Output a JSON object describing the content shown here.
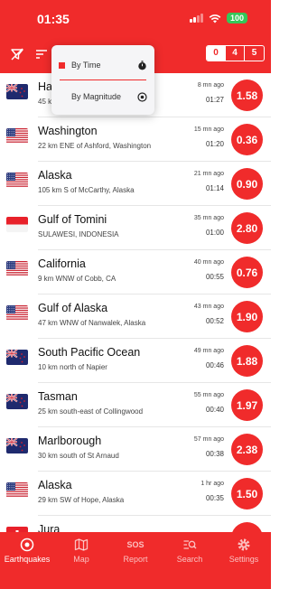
{
  "status_bar": {
    "time": "01:35",
    "battery": "100"
  },
  "toolbar": {
    "counts": [
      "0",
      "4",
      "5"
    ]
  },
  "sort_menu": {
    "items": [
      {
        "label": "By Time",
        "selected": true,
        "icon": "stopwatch-icon"
      },
      {
        "label": "By Magnitude",
        "selected": false,
        "icon": "target-icon"
      }
    ]
  },
  "earthquakes": [
    {
      "place": "Ha",
      "detail": "45 k",
      "ago": "8 mn ago",
      "time": "01:27",
      "magnitude": "1.58",
      "flag": "nz"
    },
    {
      "place": "Washington",
      "detail": "22 km ENE of Ashford, Washington",
      "ago": "15 mn ago",
      "time": "01:20",
      "magnitude": "0.36",
      "flag": "us"
    },
    {
      "place": "Alaska",
      "detail": "105 km S of McCarthy, Alaska",
      "ago": "21 mn ago",
      "time": "01:14",
      "magnitude": "0.90",
      "flag": "us"
    },
    {
      "place": "Gulf of Tomini",
      "detail": "SULAWESI, INDONESIA",
      "ago": "35 mn ago",
      "time": "01:00",
      "magnitude": "2.80",
      "flag": "id"
    },
    {
      "place": "California",
      "detail": "9 km WNW of Cobb, CA",
      "ago": "40 mn ago",
      "time": "00:55",
      "magnitude": "0.76",
      "flag": "us"
    },
    {
      "place": "Gulf of Alaska",
      "detail": "47 km WNW of Nanwalek, Alaska",
      "ago": "43 mn ago",
      "time": "00:52",
      "magnitude": "1.90",
      "flag": "us"
    },
    {
      "place": "South Pacific Ocean",
      "detail": "10 km north of Napier",
      "ago": "49 mn ago",
      "time": "00:46",
      "magnitude": "1.88",
      "flag": "nz"
    },
    {
      "place": "Tasman",
      "detail": "25 km south-east of Collingwood",
      "ago": "55 mn ago",
      "time": "00:40",
      "magnitude": "1.97",
      "flag": "nz"
    },
    {
      "place": "Marlborough",
      "detail": "30 km south of St Arnaud",
      "ago": "57 mn ago",
      "time": "00:38",
      "magnitude": "2.38",
      "flag": "nz"
    },
    {
      "place": "Alaska",
      "detail": "29 km SW of Hope, Alaska",
      "ago": "1 hr ago",
      "time": "00:35",
      "magnitude": "1.50",
      "flag": "us"
    },
    {
      "place": "Jura",
      "detail": "",
      "ago": "",
      "time": "",
      "magnitude": "",
      "flag": "ch"
    }
  ],
  "tabs": [
    {
      "label": "Earthquakes",
      "icon": "target-icon",
      "active": true
    },
    {
      "label": "Map",
      "icon": "map-icon",
      "active": false
    },
    {
      "label": "Report",
      "icon": "sos-icon",
      "text": "SOS",
      "active": false
    },
    {
      "label": "Search",
      "icon": "search-icon",
      "active": false
    },
    {
      "label": "Settings",
      "icon": "gear-icon",
      "active": false
    }
  ],
  "colors": {
    "accent": "#f02b2b",
    "battery": "#35c759"
  }
}
